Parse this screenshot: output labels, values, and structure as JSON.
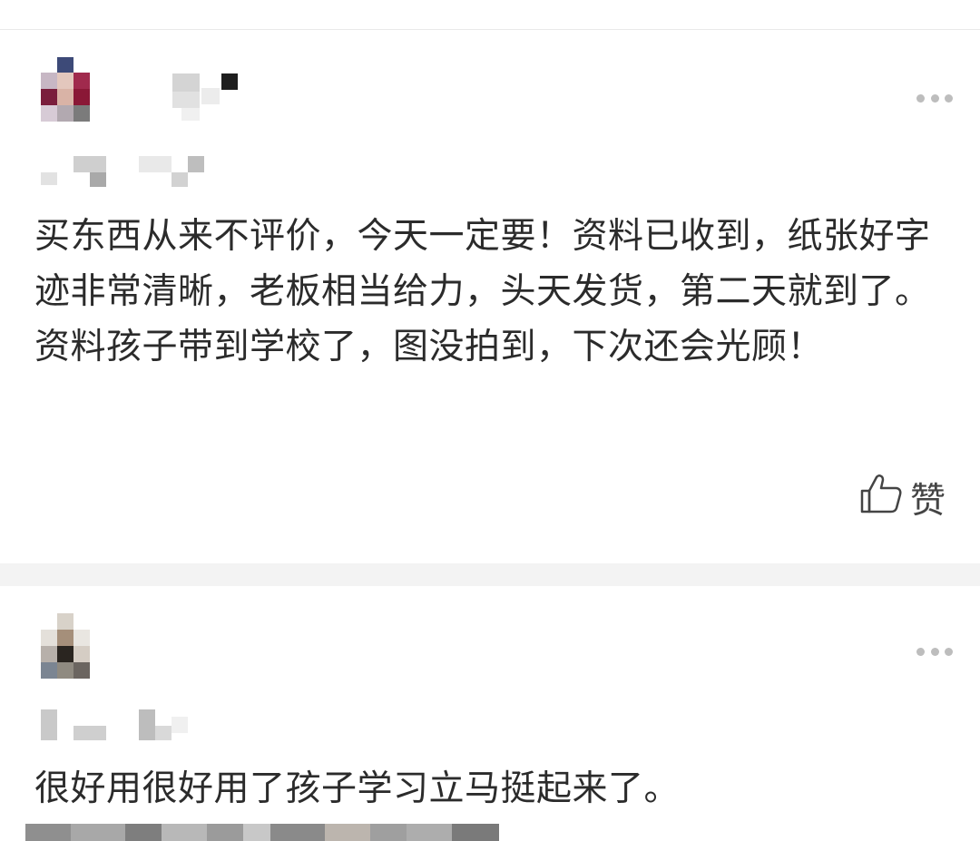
{
  "reviews": [
    {
      "text": "买东西从来不评价，今天一定要！资料已收到，纸张好字迹非常清晰，老板相当给力，头天发货，第二天就到了。资料孩子带到学校了，图没拍到，下次还会光顾！",
      "like_label": "赞",
      "icons": {
        "more": "more-dots-icon",
        "like": "thumbs-up-icon"
      }
    },
    {
      "text": "很好用很好用了孩子学习立马挺起来了。",
      "icons": {
        "more": "more-dots-icon"
      }
    }
  ],
  "colors": {
    "text": "#2b2b2b",
    "divider": "#f3f3f3",
    "more_dots": "#bdbdbd"
  }
}
